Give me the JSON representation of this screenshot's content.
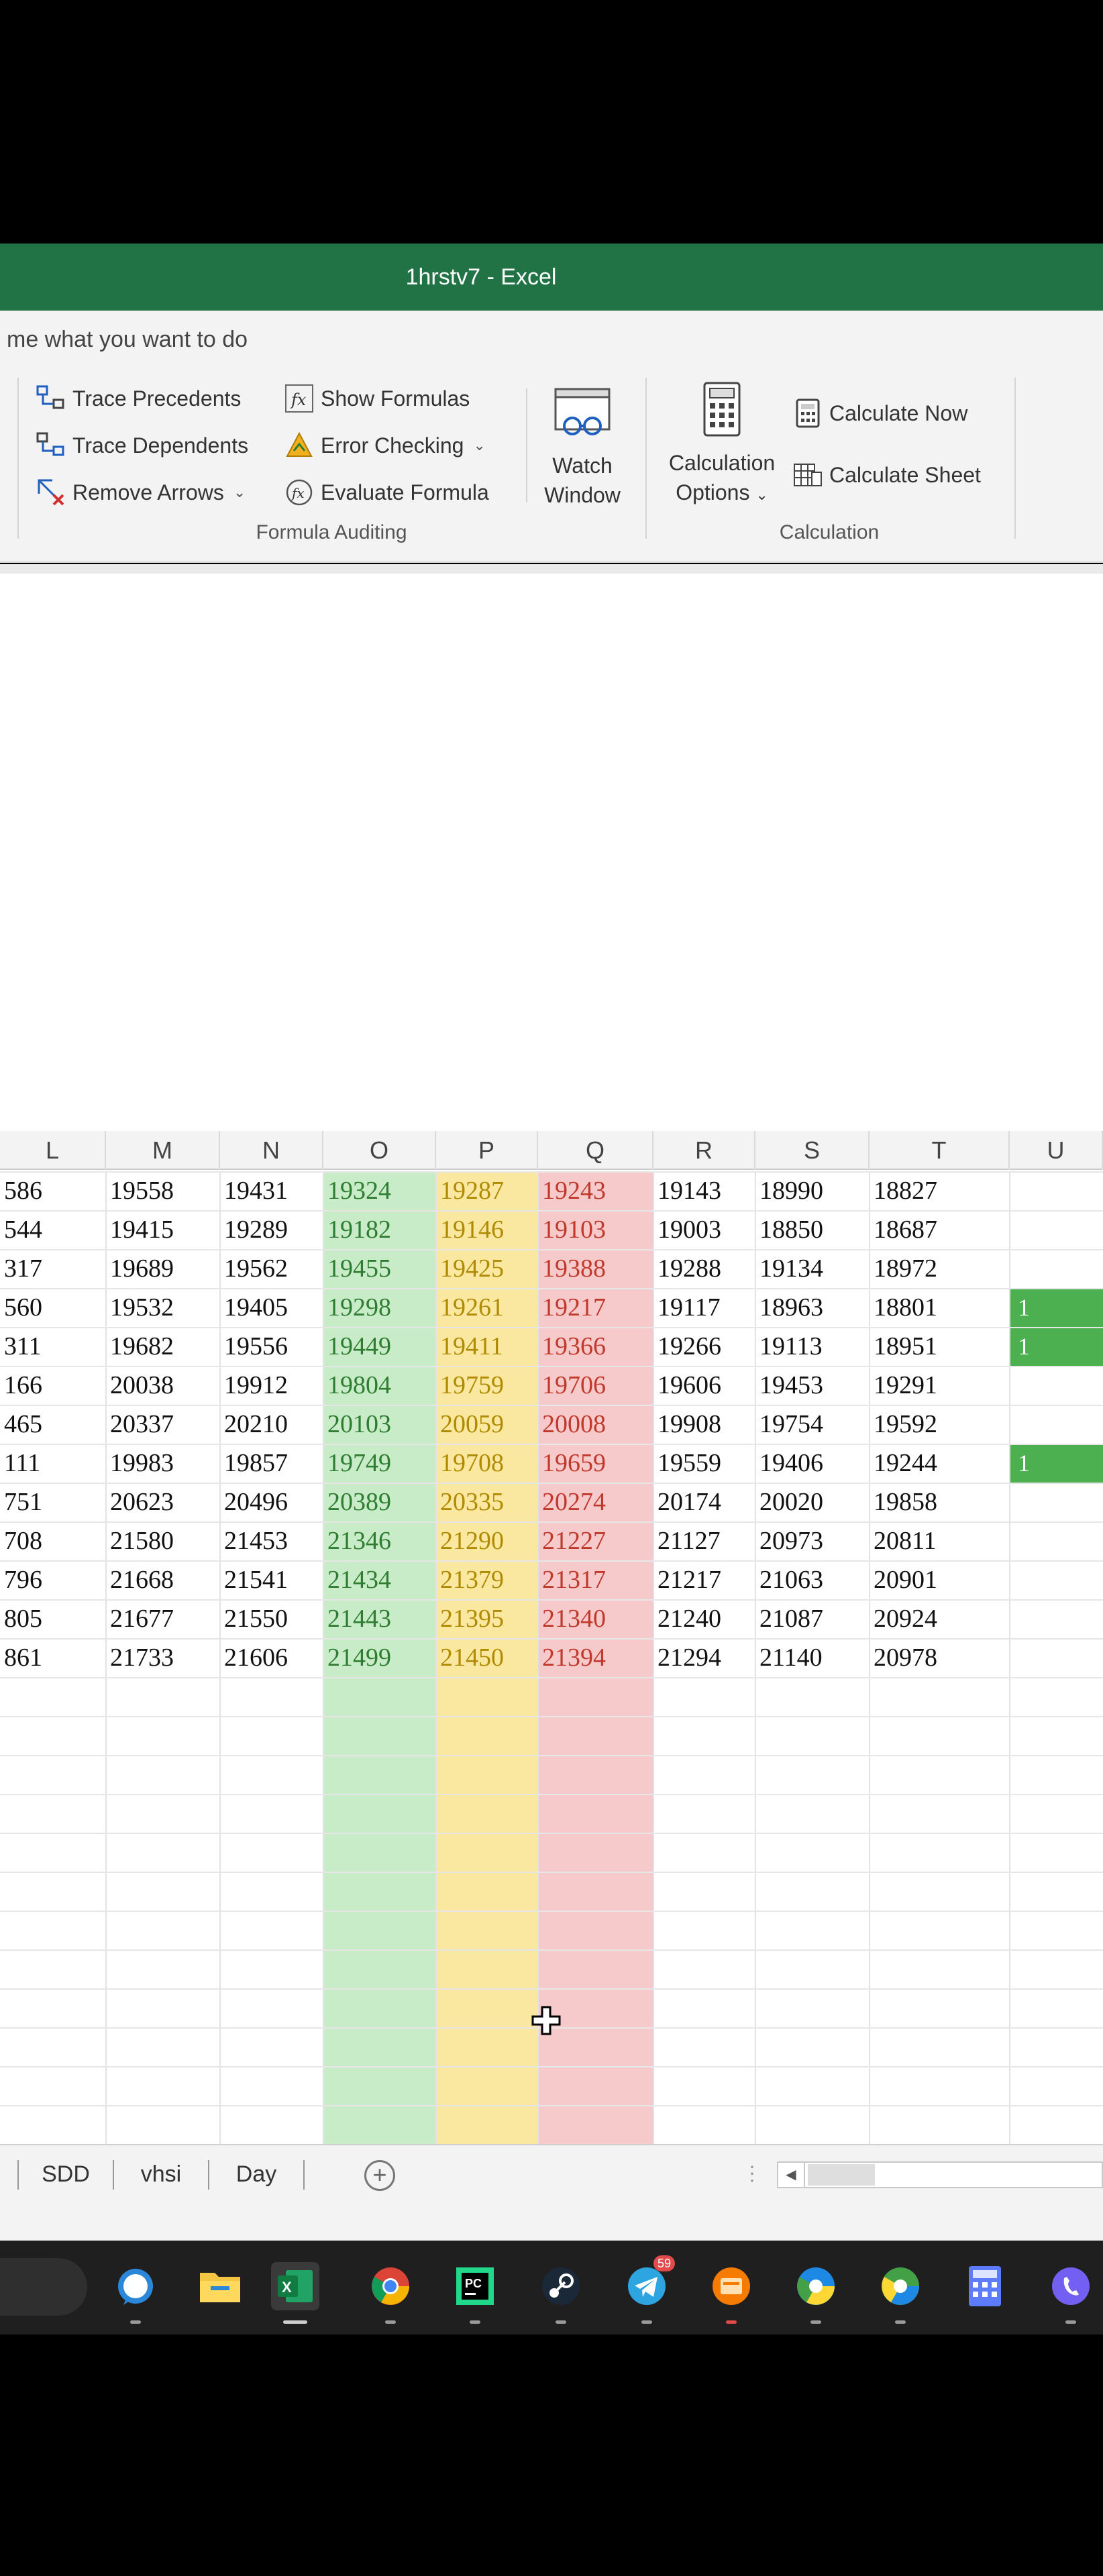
{
  "window": {
    "title": "1hrstv7  -  Excel"
  },
  "tell_me": {
    "text": "me what you want to do"
  },
  "ribbon": {
    "auditing": {
      "trace_precedents": "Trace Precedents",
      "trace_dependents": "Trace Dependents",
      "remove_arrows": "Remove Arrows",
      "show_formulas": "Show Formulas",
      "error_checking": "Error Checking",
      "evaluate_formula": "Evaluate Formula",
      "watch_window_1": "Watch",
      "watch_window_2": "Window",
      "group_label": "Formula Auditing"
    },
    "calculation": {
      "options_1": "Calculation",
      "options_2": "Options",
      "calculate_now": "Calculate Now",
      "calculate_sheet": "Calculate Sheet",
      "group_label": "Calculation"
    }
  },
  "sheet": {
    "columns": [
      "L",
      "M",
      "N",
      "O",
      "P",
      "Q",
      "R",
      "S",
      "T",
      "U"
    ],
    "rows": [
      [
        "586",
        "19558",
        "19431",
        "19324",
        "19287",
        "19243",
        "19143",
        "18990",
        "18827",
        ""
      ],
      [
        "544",
        "19415",
        "19289",
        "19182",
        "19146",
        "19103",
        "19003",
        "18850",
        "18687",
        ""
      ],
      [
        "317",
        "19689",
        "19562",
        "19455",
        "19425",
        "19388",
        "19288",
        "19134",
        "18972",
        ""
      ],
      [
        "560",
        "19532",
        "19405",
        "19298",
        "19261",
        "19217",
        "19117",
        "18963",
        "18801",
        "1"
      ],
      [
        "311",
        "19682",
        "19556",
        "19449",
        "19411",
        "19366",
        "19266",
        "19113",
        "18951",
        "1"
      ],
      [
        "166",
        "20038",
        "19912",
        "19804",
        "19759",
        "19706",
        "19606",
        "19453",
        "19291",
        ""
      ],
      [
        "465",
        "20337",
        "20210",
        "20103",
        "20059",
        "20008",
        "19908",
        "19754",
        "19592",
        ""
      ],
      [
        "111",
        "19983",
        "19857",
        "19749",
        "19708",
        "19659",
        "19559",
        "19406",
        "19244",
        "1"
      ],
      [
        "751",
        "20623",
        "20496",
        "20389",
        "20335",
        "20274",
        "20174",
        "20020",
        "19858",
        ""
      ],
      [
        "708",
        "21580",
        "21453",
        "21346",
        "21290",
        "21227",
        "21127",
        "20973",
        "20811",
        ""
      ],
      [
        "796",
        "21668",
        "21541",
        "21434",
        "21379",
        "21317",
        "21217",
        "21063",
        "20901",
        ""
      ],
      [
        "805",
        "21677",
        "21550",
        "21443",
        "21395",
        "21340",
        "21240",
        "21087",
        "20924",
        ""
      ],
      [
        "861",
        "21733",
        "21606",
        "21499",
        "21450",
        "21394",
        "21294",
        "21140",
        "20978",
        ""
      ]
    ],
    "colors": {
      "O_fill": "#c9ecc8",
      "P_fill": "#fbe8a0",
      "Q_fill": "#f6c9cb",
      "U_fill": "#4caf50"
    }
  },
  "tabs": {
    "items": [
      "SDD",
      "vhsi",
      "Day"
    ],
    "add_label": "+"
  },
  "taskbar": {
    "icons": [
      "cortana-icon",
      "file-explorer-icon",
      "excel-icon",
      "chrome-icon",
      "pycharm-icon",
      "steam-icon",
      "telegram-icon",
      "app-icon",
      "chromium-icon",
      "chromium-alt-icon",
      "calculator-icon",
      "viber-icon"
    ],
    "telegram_badge": "59"
  }
}
